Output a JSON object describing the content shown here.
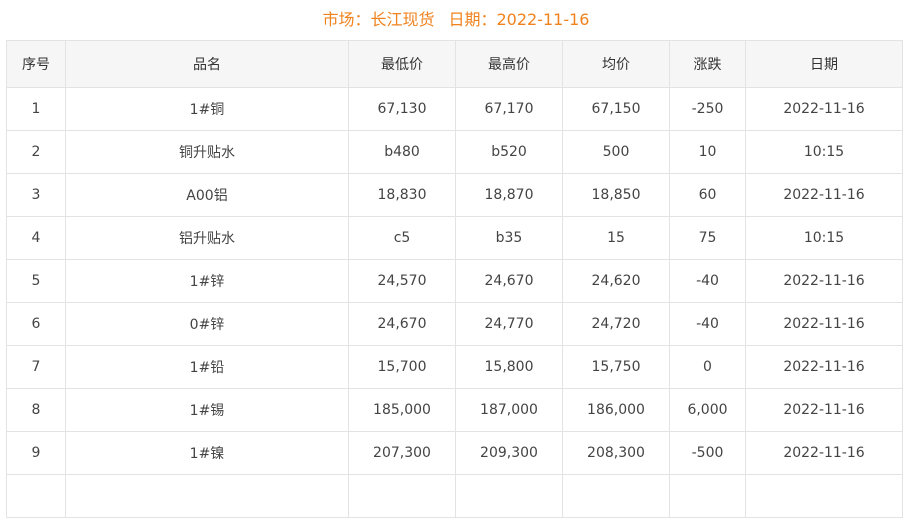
{
  "header": {
    "market_label": "市场：长江现货",
    "date_label": "日期：2022-11-16"
  },
  "table": {
    "columns": [
      "序号",
      "品名",
      "最低价",
      "最高价",
      "均价",
      "涨跌",
      "日期"
    ],
    "rows": [
      {
        "no": "1",
        "name": "1#铜",
        "low": "67,130",
        "high": "67,170",
        "avg": "67,150",
        "change": "-250",
        "direction": "down",
        "date": "2022-11-16"
      },
      {
        "no": "2",
        "name": "铜升贴水",
        "low": "b480",
        "high": "b520",
        "avg": "500",
        "change": "10",
        "direction": "up",
        "date": "10:15"
      },
      {
        "no": "3",
        "name": "A00铝",
        "low": "18,830",
        "high": "18,870",
        "avg": "18,850",
        "change": "60",
        "direction": "up",
        "date": "2022-11-16"
      },
      {
        "no": "4",
        "name": "铝升贴水",
        "low": "c5",
        "high": "b35",
        "avg": "15",
        "change": "75",
        "direction": "up",
        "date": "10:15"
      },
      {
        "no": "5",
        "name": "1#锌",
        "low": "24,570",
        "high": "24,670",
        "avg": "24,620",
        "change": "-40",
        "direction": "down",
        "date": "2022-11-16"
      },
      {
        "no": "6",
        "name": "0#锌",
        "low": "24,670",
        "high": "24,770",
        "avg": "24,720",
        "change": "-40",
        "direction": "down",
        "date": "2022-11-16"
      },
      {
        "no": "7",
        "name": "1#铅",
        "low": "15,700",
        "high": "15,800",
        "avg": "15,750",
        "change": "0",
        "direction": "flat",
        "date": "2022-11-16"
      },
      {
        "no": "8",
        "name": "1#锡",
        "low": "185,000",
        "high": "187,000",
        "avg": "186,000",
        "change": "6,000",
        "direction": "up",
        "date": "2022-11-16"
      },
      {
        "no": "9",
        "name": "1#镍",
        "low": "207,300",
        "high": "209,300",
        "avg": "208,300",
        "change": "-500",
        "direction": "down",
        "date": "2022-11-16"
      }
    ]
  },
  "colors": {
    "title": "#f0821e",
    "down": "#1a8a1a",
    "up": "#e60012",
    "flat": "#aaaaaa"
  }
}
